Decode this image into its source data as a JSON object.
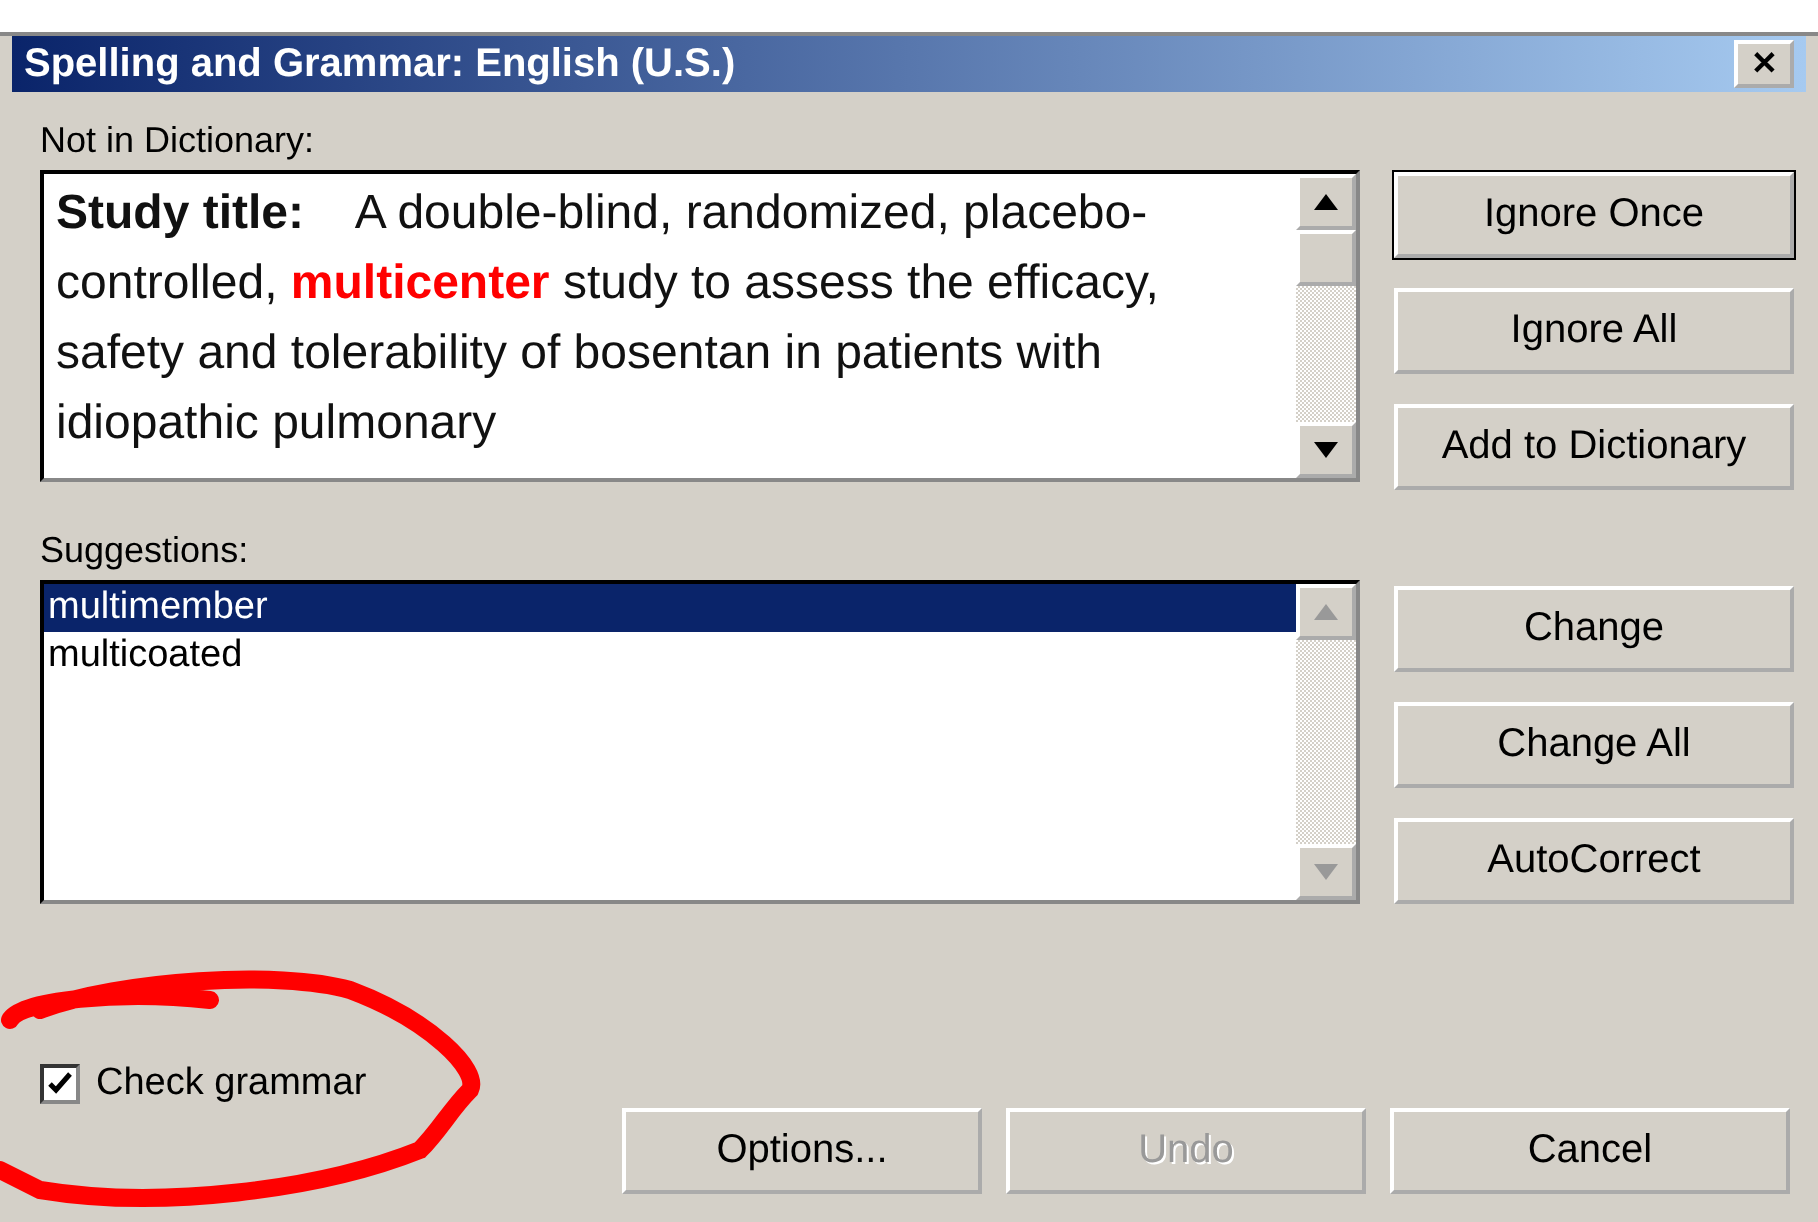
{
  "window": {
    "title": "Spelling and Grammar: English (U.S.)",
    "close": "✕"
  },
  "not_in_dictionary": {
    "label": "Not in Dictionary:",
    "heading": "Study title:",
    "text": "A double-blind, randomized, placebo-controlled, **multicenter** study to assess the efficacy, safety and tolerability of bosentan in patients with idiopathic pulmonary"
  },
  "side_buttons_top": [
    {
      "label": "Ignore Once",
      "default": true
    },
    {
      "label": "Ignore All",
      "default": false
    },
    {
      "label": "Add to Dictionary",
      "default": false
    }
  ],
  "suggestions": {
    "label": "Suggestions:",
    "items": [
      {
        "text": "multimember",
        "selected": true
      },
      {
        "text": "multicoated",
        "selected": false
      }
    ]
  },
  "side_buttons_bottom": [
    {
      "label": "Change",
      "default": false
    },
    {
      "label": "Change All",
      "default": false
    },
    {
      "label": "AutoCorrect",
      "default": false
    }
  ],
  "check_grammar": {
    "label": "Check grammar",
    "checked": true
  },
  "footer_buttons": [
    {
      "label": "Options...",
      "disabled": false
    },
    {
      "label": "Undo",
      "disabled": true
    },
    {
      "label": "Cancel",
      "disabled": false
    }
  ]
}
